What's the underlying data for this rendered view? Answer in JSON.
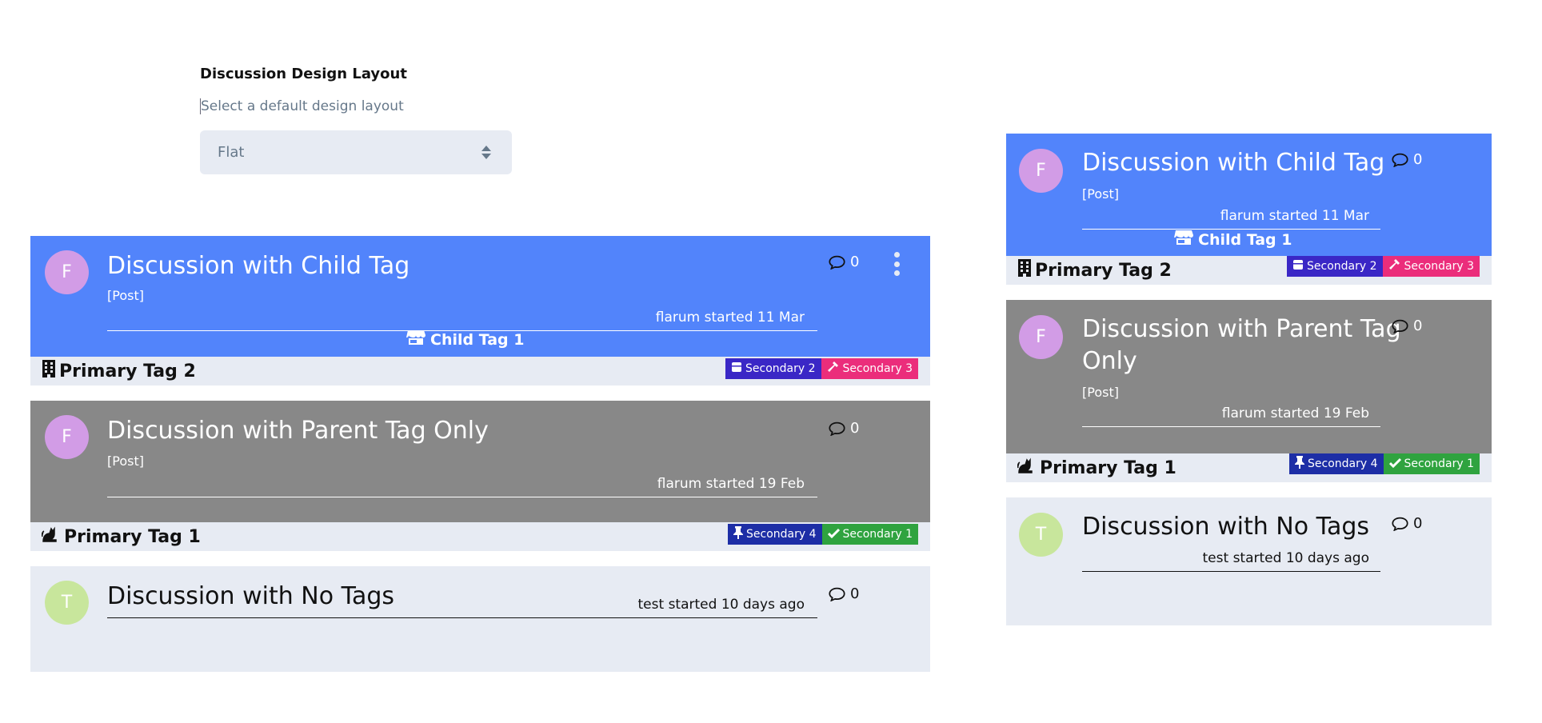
{
  "setting": {
    "title": "Discussion Design Layout",
    "help": "Select a default design layout",
    "selected": "Flat"
  },
  "wide": {
    "cards": [
      {
        "avatar": "F",
        "title": "Discussion with Child Tag",
        "post": "[Post]",
        "started": "flarum started 11 Mar",
        "replies": "0",
        "child_tag": "Child Tag 1",
        "primary_tag": "Primary Tag 2",
        "secondary": [
          "Secondary 2",
          "Secondary 3"
        ]
      },
      {
        "avatar": "F",
        "title": "Discussion with Parent Tag Only",
        "post": "[Post]",
        "started": "flarum started 19 Feb",
        "replies": "0",
        "primary_tag": "Primary Tag 1",
        "secondary": [
          "Secondary 4",
          "Secondary 1"
        ]
      },
      {
        "avatar": "T",
        "title": "Discussion with No Tags",
        "started": "test started 10 days ago",
        "replies": "0"
      }
    ]
  },
  "narrow": {
    "cards": [
      {
        "avatar": "F",
        "title": "Discussion with Child Tag",
        "post": "[Post]",
        "started": "flarum started 11 Mar",
        "replies": "0",
        "child_tag": "Child Tag 1",
        "primary_tag": "Primary Tag 2",
        "secondary": [
          "Secondary 2",
          "Secondary 3"
        ]
      },
      {
        "avatar": "F",
        "title_line1": "Discussion with Parent Tag",
        "title_line2": "Only",
        "post": "[Post]",
        "started": "flarum started 19 Feb",
        "replies": "0",
        "primary_tag": "Primary Tag 1",
        "secondary": [
          "Secondary 4",
          "Secondary 1"
        ]
      },
      {
        "avatar": "T",
        "title": "Discussion with No Tags",
        "started": "test started 10 days ago",
        "replies": "0"
      }
    ]
  },
  "icons": {
    "replies": "comment-icon",
    "menu": "ellipsis-vertical-icon",
    "child_tag": "store-icon",
    "primary_tag_2": "building-icon",
    "primary_tag_1": "cat-icon",
    "secondary_2": "box-icon",
    "secondary_3": "hammer-icon",
    "secondary_4": "thumbtack-icon",
    "secondary_1": "check-icon"
  },
  "colors": {
    "blue": "#5284fb",
    "gray": "#888888",
    "light": "#e7ebf3",
    "secondary_2": "#3a27c6",
    "secondary_3": "#eb2d7b",
    "secondary_4": "#1d2ea6",
    "secondary_1": "#2fa33f"
  }
}
